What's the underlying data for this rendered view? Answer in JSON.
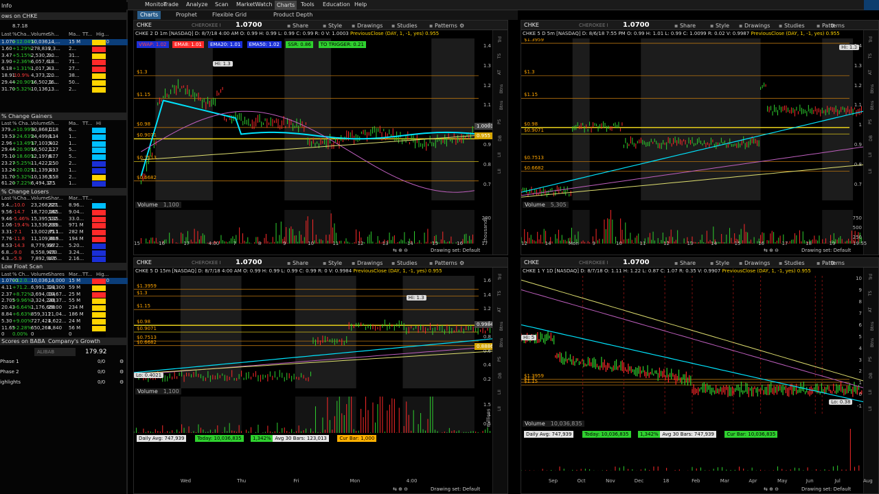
{
  "menu": {
    "items": [
      "Monitor",
      "Trade",
      "Analyze",
      "Scan",
      "MarketWatch",
      "Charts",
      "Tools",
      "Education",
      "Help"
    ],
    "active": "Charts"
  },
  "subtabs": [
    "Charts",
    "Prophet",
    "Flexible Grid",
    "Product Depth"
  ],
  "left": {
    "title_fragment": "Info",
    "watch_fragment": "ows on CHKE",
    "watch_value": "8.7.18",
    "watch_cols": [
      "Last",
      "%Cha...",
      "Volume",
      "Sh...",
      "Ma...",
      "TT...",
      "Hig..."
    ],
    "watch_rows": [
      {
        "last": "1.070",
        "chg": "+12.04%",
        "vol": "10,036,...",
        "sh": "14,...",
        "mc": "15 M",
        "tt": "",
        "hi": "2.0",
        "hl": true
      },
      {
        "last": "1.60",
        "chg": "+1.29%",
        "vol": "278,839",
        "sh": "2,3...",
        "mc": "2...",
        "tt": "",
        "hi": ""
      },
      {
        "last": "3.47",
        "chg": "+5.15%",
        "vol": "2,530,2...",
        "sh": "90...",
        "mc": "31...",
        "tt": "",
        "hi": ""
      },
      {
        "last": "3.90",
        "chg": "+2.36%",
        "vol": "6,057,6...",
        "sh": "18...",
        "mc": "71...",
        "tt": "",
        "hi": ""
      },
      {
        "last": "6.18",
        "chg": "+1.31%",
        "vol": "1,017,2...",
        "sh": "43...",
        "mc": "27...",
        "tt": "",
        "hi": ""
      },
      {
        "last": "18.91",
        "chg": "-10.9%",
        "vol": "4,373,2...",
        "sh": "20...",
        "mc": "38...",
        "tt": "",
        "hi": ""
      },
      {
        "last": "29.44",
        "chg": "+20.90%",
        "vol": "16,502,1...",
        "sh": "16...",
        "mc": "50...",
        "tt": "",
        "hi": ""
      },
      {
        "last": "31.70",
        "chg": "+5.32%",
        "vol": "10,136,...",
        "sh": "13...",
        "mc": "2...",
        "tt": "",
        "hi": ""
      }
    ],
    "gainers_title": "% Change Gainers",
    "gainers_cols": [
      "Last",
      "% Cha...",
      "Volume",
      "Sh...",
      "Ma..",
      "TT...",
      "Hi"
    ],
    "gainers": [
      {
        "last": "379...",
        "chg": "+10.99%",
        "vol": "30,868,018",
        "sh": "1...",
        "mc": "6..."
      },
      {
        "last": "19.53",
        "chg": "+24.63%",
        "vol": "24,499,134",
        "sh": "8...",
        "mc": "1..."
      },
      {
        "last": "2.96",
        "chg": "+13.49%",
        "vol": "17,103,402",
        "sh": "5...",
        "mc": "1..."
      },
      {
        "last": "29.44",
        "chg": "+20.90%",
        "vol": "16,502,127",
        "sh": "1...",
        "mc": "5..."
      },
      {
        "last": "75.10",
        "chg": "+18.60%",
        "vol": "12,197,677",
        "sh": "6...",
        "mc": "5..."
      },
      {
        "last": "23.27",
        "chg": "+5.25%",
        "vol": "11,422,250",
        "sh": "1...",
        "mc": "2..."
      },
      {
        "last": "13.24",
        "chg": "+20.02%",
        "vol": "11,139,493",
        "sh": "1...",
        "mc": "1..."
      },
      {
        "last": "31.70",
        "chg": "+5.32%",
        "vol": "10,136,558",
        "sh": "3...",
        "mc": "2..."
      },
      {
        "last": "61.20",
        "chg": "+7.22%",
        "vol": "6,494,375",
        "sh": "2...",
        "mc": "1..."
      }
    ],
    "losers_title": "% Change Losers",
    "losers_cols": [
      "Last",
      "%Cha...",
      "Volume",
      "Shar...",
      "Mar...",
      "TT..."
    ],
    "losers": [
      {
        "last": "9.4...",
        "chg": "-10.0",
        "vol": "23,268,821",
        "sh": "227...",
        "mc": "8.96..."
      },
      {
        "last": "9.56",
        "chg": "-14.7",
        "vol": "18,720,165",
        "sh": "182...",
        "mc": "9.04..."
      },
      {
        "last": "9.46",
        "chg": "-5.46%",
        "vol": "15,395,135",
        "sh": "512...",
        "mc": "33.0..."
      },
      {
        "last": "1.06",
        "chg": "-19.4%",
        "vol": "13,536,839",
        "sh": "233...",
        "mc": "971 M"
      },
      {
        "last": "3.31",
        "chg": "-7.1",
        "vol": "13,002,711",
        "sh": "85.1...",
        "mc": "282 M"
      },
      {
        "last": "7.76",
        "chg": "-11.8",
        "vol": "11,109,408",
        "sh": "39.5...",
        "mc": "194 M"
      },
      {
        "last": "8.53",
        "chg": "-14.3",
        "vol": "8,779,937",
        "sh": "66.2...",
        "mc": "5.20..."
      },
      {
        "last": "6.8...",
        "chg": "-9.0",
        "vol": "8,558,928",
        "sh": "473...",
        "mc": "3.24..."
      },
      {
        "last": "4.3...",
        "chg": "-5.9",
        "vol": "7,892,943",
        "sh": "175...",
        "mc": "2.16..."
      }
    ],
    "lowfloat_title": "Low Float Scan",
    "lowfloat_cols": [
      "Last",
      "% Ch...",
      "Volume",
      "Shares",
      "Mar...",
      "TT...",
      "Hig..."
    ],
    "lowfloat": [
      {
        "last": "1.0700",
        "chg": "+12.0...",
        "vol": "10,036,...",
        "sh": "14,000",
        "mc": "15 M",
        "hi": "2.0",
        "hl": true
      },
      {
        "last": "4.11",
        "chg": "+71.2...",
        "vol": "6,991,323",
        "sh": "14,300",
        "mc": "59 M"
      },
      {
        "last": "2.37",
        "chg": "+8.72%",
        "vol": "3,694,034",
        "sh": "10,67...",
        "mc": "25 M"
      },
      {
        "last": "2.705",
        "chg": "+9.96%",
        "vol": "3,324,248",
        "sh": "20,37...",
        "mc": "55 M"
      },
      {
        "last": "20.43",
        "chg": "+6.64%",
        "vol": "1,176,660",
        "sh": "29.00",
        "mc": "234 M"
      },
      {
        "last": "8.84",
        "chg": "+6.63%",
        "vol": "859,311",
        "sh": "21,04...",
        "mc": "186 M"
      },
      {
        "last": "5.30",
        "chg": "+9.00%",
        "vol": "727,421",
        "sh": "4,622...",
        "mc": "24 M"
      },
      {
        "last": "11.65",
        "chg": "+2.28%",
        "vol": "650,268",
        "sh": "4,840",
        "mc": "56 M"
      },
      {
        "last": "0",
        "chg": "0.00%",
        "vol": "0",
        "sh": "",
        "mc": "0",
        "hi": "0"
      }
    ],
    "scores_title": "Scores on BABA",
    "growth_title": "Company's Growth",
    "baba_sym": "ALIBAB",
    "baba_price": "179.92",
    "phases": [
      {
        "label": "Phase 1",
        "val": "0/0"
      },
      {
        "label": "Phase 2",
        "val": "0/0"
      },
      {
        "label": "ighlights",
        "val": "0/0"
      }
    ]
  },
  "charts": [
    {
      "id": "tl",
      "symbol": "CHKE",
      "company": "CHEROKEE I",
      "price": "1.0700",
      "toolbar": [
        "Share",
        "Style",
        "Drawings",
        "Studies",
        "Patterns"
      ],
      "info": "CHKE 2 D 1m [NASDAQ]  D: 8/7/18 4:00 AM  O: 0.99  H: 0.99  L: 0.99  C: 0.99  R: 0  V: 1.0003",
      "prev": "PreviousClose (DAY, 1, -1, yes)  0.955",
      "indicators": [
        {
          "text": "VWAP: 1.02",
          "bg": "#1a2fd6",
          "color": "#ff4444"
        },
        {
          "text": "EMA8: 1.01",
          "bg": "#ff2a2a",
          "color": "#ffffff"
        },
        {
          "text": "EMA20: 1.01",
          "bg": "#1a2fd6",
          "color": "#ffffff"
        },
        {
          "text": "EMA50: 1.02",
          "bg": "#1a2fd6",
          "color": "#ffffff"
        },
        {
          "text": "SSR: 0.86",
          "bg": "#2fd12f",
          "color": "#000000"
        },
        {
          "text": "TO TRIGGER: 0.21",
          "bg": "#2fd12f",
          "color": "#000000"
        }
      ],
      "hi_label": "Hi: 1.3",
      "levels": [
        "$1.3",
        "$1.15",
        "$0.98",
        "$0.9071",
        "$0.7513",
        "$0.6682"
      ],
      "yticks": [
        "1.4",
        "1.3",
        "1.2",
        "1.1",
        "1",
        "0.9",
        "0.8",
        "0.7"
      ],
      "price_tags": [
        "1.0003",
        "0.955"
      ],
      "volume_label": "Volume",
      "volume_value": "1,100",
      "vol_yticks": [
        "200"
      ],
      "vol_unit": "thousands",
      "xticks": [
        "15",
        "16",
        "17",
        "4:00",
        "7",
        "8",
        "9",
        "10",
        "11",
        "12",
        "13",
        "14",
        "15",
        "16",
        "17"
      ],
      "drawing_set": "Drawing set: Default"
    },
    {
      "id": "tr",
      "symbol": "CHKE",
      "company": "CHEROKEE I",
      "price": "1.0700",
      "toolbar": [
        "Share",
        "Style",
        "Drawings",
        "Studies",
        "Patterns"
      ],
      "info": "CHKE 5 D 5m [NASDAQ]  D: 8/6/18 7:55 PM  O: 0.99  H: 1.01  L: 0.99  C: 1.0099  R: 0.02  V: 0.9987",
      "prev": "PreviousClose (DAY, 1, -1, yes)  0.955",
      "hi_label": "Hi: 1.3",
      "levels": [
        "$1.3959",
        "$1.3",
        "$1.15",
        "$0.98",
        "$0.9071",
        "$0.7513",
        "$0.6682"
      ],
      "yticks": [
        "1.4",
        "1.3",
        "1.2",
        "1.1",
        "1",
        "0.9",
        "0.8",
        "0.7"
      ],
      "volume_label": "Volume",
      "volume_value": "5,305",
      "vol_yticks": [
        "750",
        "500",
        "250"
      ],
      "xticks": [
        "12",
        "14",
        "Mon",
        "9",
        "10",
        "11",
        "12",
        "13",
        "14",
        "15",
        "16",
        "17",
        "18",
        "19",
        "19:55"
      ],
      "drawing_set": "Drawing set: Default"
    },
    {
      "id": "bl",
      "symbol": "CHKE",
      "company": "CHEROKEE I",
      "price": "1.0700",
      "toolbar": [
        "Share",
        "Style",
        "Drawings",
        "Studies",
        "Patterns"
      ],
      "info": "CHKE 5 D 15m [NASDAQ]  D: 8/7/18 4:00 AM  O: 0.99  H: 0.99  L: 0.99  C: 0.99  R: 0  V: 0.9984",
      "prev": "PreviousClose (DAY, 1, -1, yes)  0.955",
      "hi_label": "Hi: 1.3",
      "lo_label": "Lo: 0.4021",
      "levels": [
        "$1.3959",
        "$1.3",
        "$1.15",
        "$0.98",
        "$0.9071",
        "$0.7513",
        "$0.6682"
      ],
      "yticks": [
        "1.6",
        "1.4",
        "1.2",
        "1",
        "0.8",
        "0.6",
        "0.4",
        "0.2"
      ],
      "price_tags": [
        "0.9984",
        "0.8886"
      ],
      "volume_label": "Volume",
      "volume_value": "1,100",
      "vol_yticks": [
        "1.5",
        "1",
        "0.5"
      ],
      "vol_unit": "millions",
      "stats": [
        {
          "text": "Daily Avg: 747,939",
          "bg": "#e6e6e6",
          "color": "#000"
        },
        {
          "text": "Today: 10,036,835",
          "bg": "#2fd12f",
          "color": "#000"
        },
        {
          "text": "1,342%",
          "bg": "#2fd12f",
          "color": "#000"
        },
        {
          "text": "Avg 30 Bars: 123,013",
          "bg": "#e6e6e6",
          "color": "#000"
        },
        {
          "text": "Cur Bar: 1,000",
          "bg": "#ffb000",
          "color": "#000"
        }
      ],
      "xticks": [
        "Wed",
        "Thu",
        "Fri",
        "Mon",
        "4:00"
      ],
      "drawing_set": "Drawing set: Default"
    },
    {
      "id": "br",
      "symbol": "CHKE",
      "company": "CHEROKEE I",
      "price": "1.0700",
      "toolbar": [
        "Share",
        "Style",
        "Drawings",
        "Studies",
        "Patterns"
      ],
      "info": "CHKE 1 Y 1D [NASDAQ]  D: 8/7/18  O: 1.11  H: 1.22  L: 0.87  C: 1.07  R: 0.35  V: 0.9907",
      "prev": "PreviousClose (DAY, 1, -1, yes)  0.955",
      "hi_label": "Hi: 5",
      "lo_label": "Lo: 0.38",
      "levels": [
        "$1.3959",
        "$1.3",
        "$1.15"
      ],
      "yticks": [
        "10",
        "9",
        "8",
        "7",
        "6",
        "5",
        "4",
        "3",
        "2",
        "1",
        "0",
        "-1"
      ],
      "volume_label": "Volume",
      "volume_value": "10,036,835",
      "stats": [
        {
          "text": "Daily Avg: 747,939",
          "bg": "#e6e6e6",
          "color": "#000"
        },
        {
          "text": "Today: 10,036,835",
          "bg": "#2fd12f",
          "color": "#000"
        },
        {
          "text": "1,342%",
          "bg": "#2fd12f",
          "color": "#000"
        },
        {
          "text": "Avg 30 Bars: 747,939",
          "bg": "#e6e6e6",
          "color": "#000"
        },
        {
          "text": "Cur Bar: 10,036,835",
          "bg": "#2fd12f",
          "color": "#000"
        }
      ],
      "xticks": [
        "Sep",
        "Oct",
        "Nov",
        "Dec",
        "18",
        "Feb",
        "Mar",
        "Apr",
        "May",
        "Jun",
        "Jul",
        "Aug"
      ],
      "drawing_set": "Drawing set: Default"
    }
  ],
  "side_tabs": [
    "Trd",
    "TS",
    "AT",
    "Btns",
    "Btns",
    "PS",
    "DB",
    "LII",
    "LII"
  ]
}
